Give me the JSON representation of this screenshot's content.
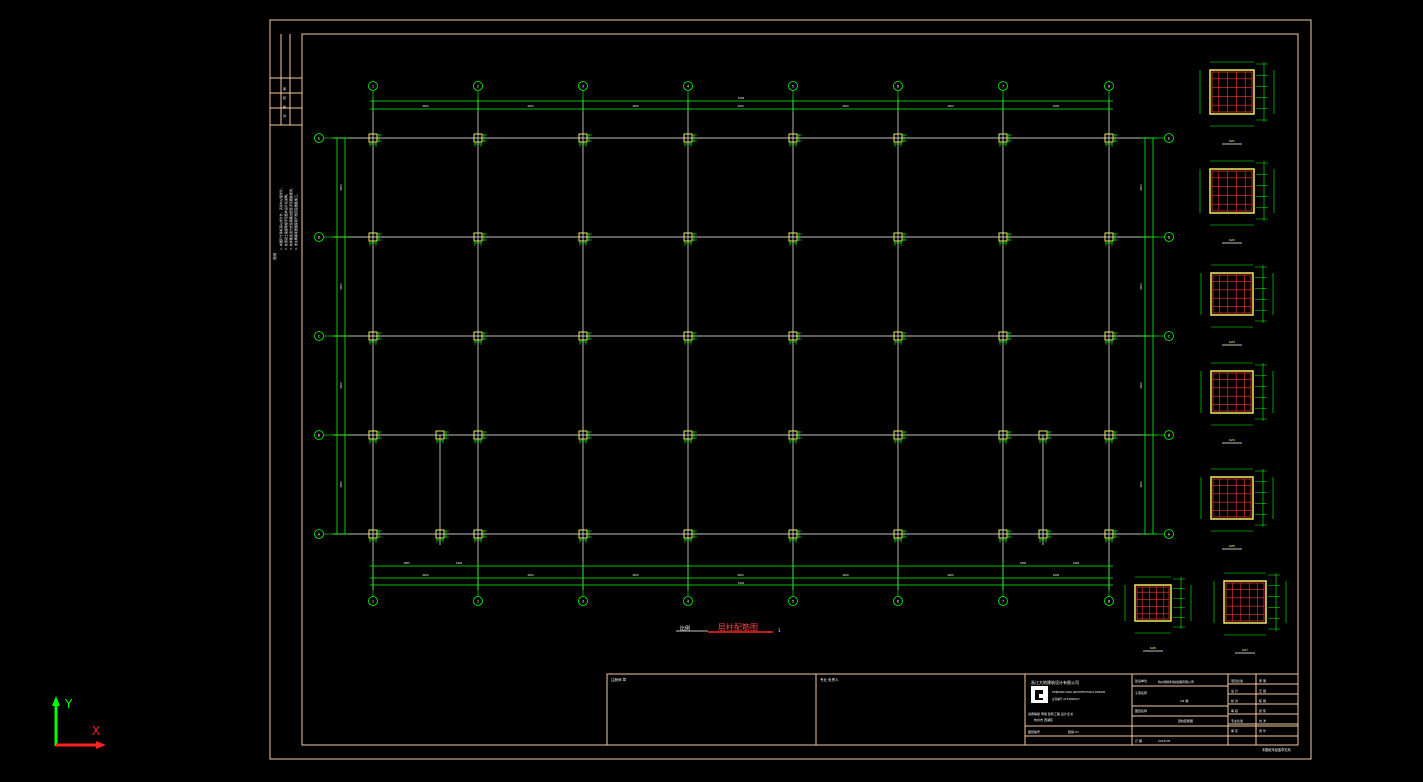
{
  "drawing": {
    "title": "层柱配筋图",
    "scale_prefix": "比例",
    "scale_suffix": "1",
    "top_total_dim": "5400",
    "bottom_total_dim": "5400"
  },
  "grid": {
    "column_labels": [
      "1",
      "2",
      "3",
      "4",
      "5",
      "6",
      "7",
      "8"
    ],
    "row_labels": [
      "E",
      "D",
      "C",
      "B",
      "A"
    ],
    "bay_dims_top": [
      "4200",
      "4200",
      "4200",
      "4200",
      "4200",
      "4200",
      "4200"
    ],
    "bay_dims_bottom_first": [
      "1800",
      "2400"
    ],
    "bay_dims_bottom_last": [
      "1800",
      "2400"
    ],
    "row_dims": [
      "3600",
      "3600",
      "3600",
      "3600"
    ]
  },
  "left_strip": {
    "notes_heading": "说明",
    "notes": [
      "1. 本图尺寸除标高以米计外，其余均以毫米计。",
      "2. 柱混凝土强度等级详见结构设计总说明。",
      "3. 柱纵筋连接方式及箍筋加密区详见图集要求。",
      "4. 未注明事项按国家现行规范及图集施工。"
    ],
    "stamp_rows": [
      "审",
      "核",
      "校",
      "对"
    ]
  },
  "sections": [
    {
      "label": "KZ1"
    },
    {
      "label": "KZ2"
    },
    {
      "label": "KZ3"
    },
    {
      "label": "KZ4"
    },
    {
      "label": "KZ5"
    },
    {
      "label": "KZ6"
    },
    {
      "label": "KZ7"
    }
  ],
  "title_block": {
    "cell1_label": "注册师 章",
    "cell2_label": "专业 负责人",
    "company_name": "浙江大地建筑设计有限公司",
    "company_sub": "ZHEJIANG DADI ARCHITECTURAL DESIGN",
    "cert_line": "资质等级  甲级    建筑工程  设计证书",
    "cert_no": "证书编号 A133000417",
    "address": "杭州市 西湖区",
    "project_label": "建设单位",
    "project_value": "杭州鼎新科技发展有限公司",
    "subitem_label": "子项名称",
    "subitem_value": "1# 楼",
    "drawing_label": "图纸名称",
    "drawing_value": "层柱配筋图",
    "right_rows": [
      [
        "项目负责",
        "李 明"
      ],
      [
        "设 计",
        "王 强"
      ],
      [
        "校 对",
        "陈 刚"
      ],
      [
        "审 核",
        "张 伟"
      ],
      [
        "专业负责",
        "刘 洋"
      ],
      [
        "审 定",
        "周 华"
      ]
    ],
    "bottom_left_a": "图纸编号",
    "bottom_left_b": "结施-07",
    "bottom_mid_a": "日 期",
    "bottom_mid_b": "2018.05",
    "footer": "本图纸未经盖章无效"
  },
  "ucs": {
    "y_label": "Y",
    "x_label": "X"
  },
  "colors": {
    "background": "#000000",
    "frame": "#f2c9a0",
    "grid_line": "#ffffff",
    "dimension": "#00ff00",
    "column": "#ffff66",
    "rebar": "#ff3333",
    "title_text": "#ff4444",
    "ucs_y": "#00ff00",
    "ucs_x": "#ff2222"
  }
}
